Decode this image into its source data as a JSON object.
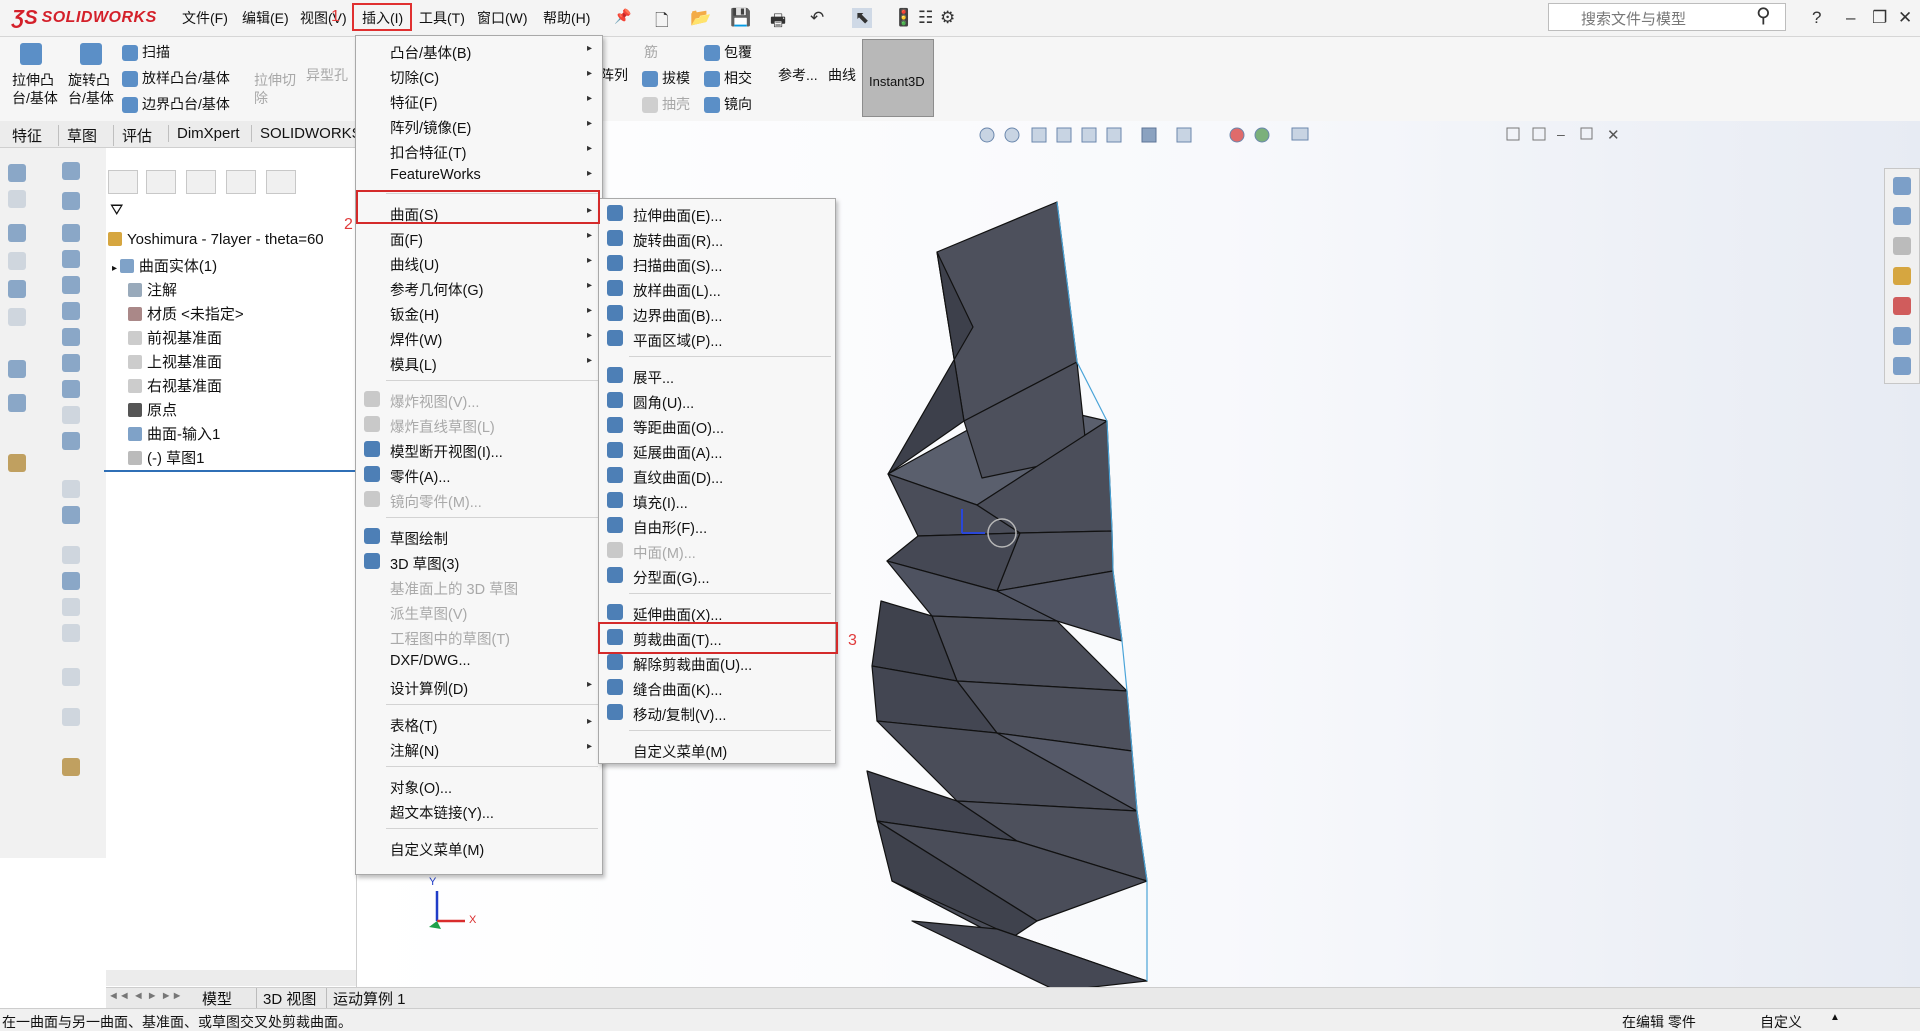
{
  "app": {
    "logo_text": "SOLIDWORKS",
    "accent_color": "#d4202a"
  },
  "main_menu": [
    "文件(F)",
    "编辑(E)",
    "视图(V)",
    "插入(I)",
    "工具(T)",
    "窗口(W)",
    "帮助(H)"
  ],
  "search": {
    "placeholder": "搜索文件与模型"
  },
  "command_bar": {
    "extrude": "拉伸凸\n台/基体",
    "revolve": "旋转凸\n台/基体",
    "sweep": "扫描",
    "loft": "放样凸台/基体",
    "boundary": "边界凸台/基体",
    "extrude_cut": "拉伸切\n除",
    "hole": "异型孔",
    "rib": "筋",
    "wrap": "包覆",
    "draft": "拔模",
    "intersect": "相交",
    "shell": "抽壳",
    "mirror": "镜向",
    "pattern": "阵列",
    "reference": "参考...",
    "curves": "曲线",
    "instant3d": "Instant3D"
  },
  "feature_tabs": [
    "特征",
    "草图",
    "评估",
    "DimXpert",
    "SOLIDWORKS"
  ],
  "tree": {
    "root": "Yoshimura - 7layer - theta=60",
    "items": [
      "曲面实体(1)",
      "注解",
      "材质 <未指定>",
      "前视基准面",
      "上视基准面",
      "右视基准面",
      "原点",
      "曲面-输入1",
      "(-) 草图1"
    ]
  },
  "insert_menu": {
    "items": [
      {
        "label": "凸台/基体(B)",
        "sub": true,
        "dis": false
      },
      {
        "label": "切除(C)",
        "sub": true,
        "dis": false
      },
      {
        "label": "特征(F)",
        "sub": true,
        "dis": false
      },
      {
        "label": "阵列/镜像(E)",
        "sub": true,
        "dis": false
      },
      {
        "label": "扣合特征(T)",
        "sub": true,
        "dis": false
      },
      {
        "label": "FeatureWorks",
        "sub": true,
        "dis": false
      },
      {
        "label": "曲面(S)",
        "sub": true,
        "dis": false
      },
      {
        "label": "面(F)",
        "sub": true,
        "dis": false
      },
      {
        "label": "曲线(U)",
        "sub": true,
        "dis": false
      },
      {
        "label": "参考几何体(G)",
        "sub": true,
        "dis": false
      },
      {
        "label": "钣金(H)",
        "sub": true,
        "dis": false
      },
      {
        "label": "焊件(W)",
        "sub": true,
        "dis": false
      },
      {
        "label": "模具(L)",
        "sub": true,
        "dis": false
      },
      {
        "label": "爆炸视图(V)...",
        "sub": false,
        "dis": true
      },
      {
        "label": "爆炸直线草图(L)",
        "sub": false,
        "dis": true
      },
      {
        "label": "模型断开视图(I)...",
        "sub": false,
        "dis": false
      },
      {
        "label": "零件(A)...",
        "sub": false,
        "dis": false
      },
      {
        "label": "镜向零件(M)...",
        "sub": false,
        "dis": true
      },
      {
        "label": "草图绘制",
        "sub": false,
        "dis": false
      },
      {
        "label": "3D 草图(3)",
        "sub": false,
        "dis": false
      },
      {
        "label": "基准面上的 3D 草图",
        "sub": false,
        "dis": true
      },
      {
        "label": "派生草图(V)",
        "sub": false,
        "dis": true
      },
      {
        "label": "工程图中的草图(T)",
        "sub": false,
        "dis": true
      },
      {
        "label": "DXF/DWG...",
        "sub": false,
        "dis": false
      },
      {
        "label": "设计算例(D)",
        "sub": true,
        "dis": false
      },
      {
        "label": "表格(T)",
        "sub": true,
        "dis": false
      },
      {
        "label": "注解(N)",
        "sub": true,
        "dis": false
      },
      {
        "label": "对象(O)...",
        "sub": false,
        "dis": false
      },
      {
        "label": "超文本链接(Y)...",
        "sub": false,
        "dis": false
      },
      {
        "label": "自定义菜单(M)",
        "sub": false,
        "dis": false
      }
    ]
  },
  "surface_menu": {
    "items": [
      {
        "label": "拉伸曲面(E)...",
        "dis": false
      },
      {
        "label": "旋转曲面(R)...",
        "dis": false
      },
      {
        "label": "扫描曲面(S)...",
        "dis": false
      },
      {
        "label": "放样曲面(L)...",
        "dis": false
      },
      {
        "label": "边界曲面(B)...",
        "dis": false
      },
      {
        "label": "平面区域(P)...",
        "dis": false
      },
      {
        "label": "展平...",
        "dis": false
      },
      {
        "label": "圆角(U)...",
        "dis": false
      },
      {
        "label": "等距曲面(O)...",
        "dis": false
      },
      {
        "label": "延展曲面(A)...",
        "dis": false
      },
      {
        "label": "直纹曲面(D)...",
        "dis": false
      },
      {
        "label": "填充(I)...",
        "dis": false
      },
      {
        "label": "自由形(F)...",
        "dis": false
      },
      {
        "label": "中面(M)...",
        "dis": true
      },
      {
        "label": "分型面(G)...",
        "dis": false
      },
      {
        "label": "延伸曲面(X)...",
        "dis": false
      },
      {
        "label": "剪裁曲面(T)...",
        "dis": false
      },
      {
        "label": "解除剪裁曲面(U)...",
        "dis": false
      },
      {
        "label": "缝合曲面(K)...",
        "dis": false
      },
      {
        "label": "移动/复制(V)...",
        "dis": false
      },
      {
        "label": "自定义菜单(M)",
        "dis": false
      }
    ]
  },
  "annotations": [
    "1",
    "2",
    "3"
  ],
  "bottom_tabs": [
    "模型",
    "3D 视图",
    "运动算例 1"
  ],
  "status": {
    "message": "在一曲面与另一曲面、基准面、或草图交叉处剪裁曲面。",
    "mode": "在编辑 零件",
    "custom": "自定义"
  },
  "triad": {
    "x": "X",
    "y": "Y"
  }
}
